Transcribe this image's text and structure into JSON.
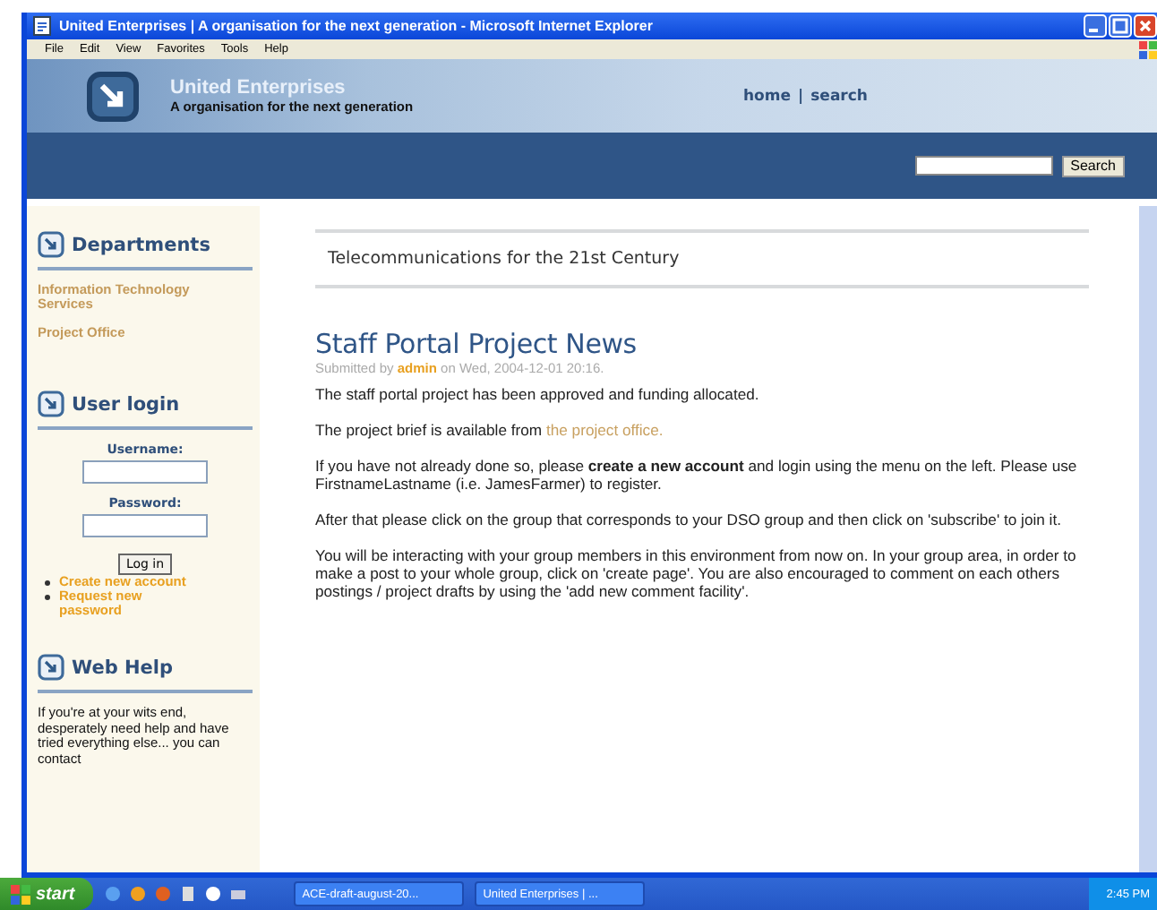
{
  "window": {
    "title": "United Enterprises | A organisation for the next generation - Microsoft Internet Explorer"
  },
  "menu": [
    "File",
    "Edit",
    "View",
    "Favorites",
    "Tools",
    "Help"
  ],
  "header": {
    "site_name": "United Enterprises",
    "slogan": "A organisation for the next generation",
    "nav": [
      "home",
      "search"
    ],
    "separator": "|"
  },
  "search": {
    "button": "Search"
  },
  "sidebar": [
    {
      "kind": "links",
      "title": "Departments",
      "items": [
        "Information Technology Services",
        "Project Office"
      ]
    },
    {
      "kind": "login",
      "title": "User login",
      "username_label": "Username:",
      "password_label": "Password:",
      "button": "Log in",
      "links": [
        "Create new account",
        "Request new password"
      ]
    },
    {
      "kind": "text",
      "title": "Web Help",
      "text": "If you're at your wits end, desperately need help and have tried everything else... you can contact"
    }
  ],
  "mission": "Telecommunications for the 21st Century",
  "post": {
    "title": "Staff Portal Project News",
    "submitted": [
      {
        "kind": "text",
        "text": "Submitted by "
      },
      {
        "kind": "link",
        "text": "admin"
      },
      {
        "kind": "text",
        "text": " on Wed, 2004-12-01 20:16."
      }
    ],
    "paragraphs": [
      [
        {
          "kind": "text",
          "text": "The staff portal project has been approved and funding allocated."
        }
      ],
      [
        {
          "kind": "text",
          "text": "The project brief is available from "
        },
        {
          "kind": "link",
          "text": "the project office."
        }
      ],
      [
        {
          "kind": "text",
          "text": "If you have not already done so, please "
        },
        {
          "kind": "bold",
          "text": "create a new account"
        },
        {
          "kind": "text",
          "text": " and login using the menu on the left. Please use FirstnameLastname (i.e. JamesFarmer) to register."
        }
      ],
      [
        {
          "kind": "text",
          "text": "After that please click on the group that corresponds to your DSO group and then click on 'subscribe' to join it."
        }
      ],
      [
        {
          "kind": "text",
          "text": "You will be interacting with your group members in this environment from now on. In your group area, in order to make a post to your whole group, click on 'create page'. You are also encouraged to comment on each others postings / project drafts by using the 'add new comment facility'."
        }
      ]
    ]
  },
  "taskbar": {
    "start": "start",
    "tasks": [
      "ACE-draft-august-20...",
      "United Enterprises | ..."
    ],
    "clock": "2:45 PM"
  }
}
